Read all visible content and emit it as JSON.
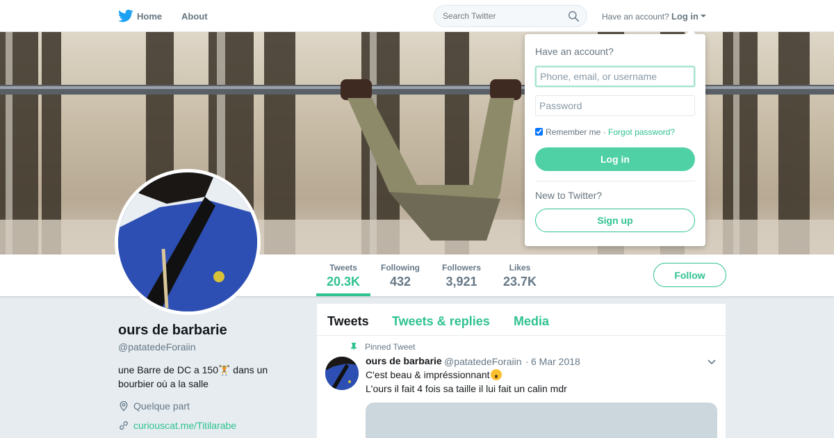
{
  "nav": {
    "home_label": "Home",
    "about_label": "About",
    "search_placeholder": "Search Twitter",
    "account_prompt": "Have an account?",
    "login_label": "Log in"
  },
  "profile": {
    "name": "ours de barbarie",
    "handle": "@patatedeForaiin",
    "bio": "une Barre de DC a 150🏋️ dans un bourbier où a la salle",
    "location": "Quelque part",
    "link": "curiouscat.me/Titilarabe"
  },
  "stats": [
    {
      "label": "Tweets",
      "value": "20.3K",
      "active": true
    },
    {
      "label": "Following",
      "value": "432",
      "active": false
    },
    {
      "label": "Followers",
      "value": "3,921",
      "active": false
    },
    {
      "label": "Likes",
      "value": "23.7K",
      "active": false
    }
  ],
  "follow_label": "Follow",
  "timeline": {
    "tabs": [
      "Tweets",
      "Tweets & replies",
      "Media"
    ],
    "pinned_label": "Pinned Tweet",
    "tweet": {
      "name": "ours de barbarie",
      "handle": "@patatedeForaiin",
      "separator": "·",
      "date": "6 Mar 2018",
      "line1": "C'est beau & impréssionnant",
      "line2": "L'ours il fait 4 fois sa taille il lui fait un calin mdr"
    }
  },
  "login_dropdown": {
    "title": "Have an account?",
    "username_placeholder": "Phone, email, or username",
    "password_placeholder": "Password",
    "remember_label": "Remember me",
    "separator": "·",
    "forgot_label": "Forgot password?",
    "login_button": "Log in",
    "new_prompt": "New to Twitter?",
    "signup_button": "Sign up"
  },
  "colors": {
    "accent": "#2fc28f",
    "muted_text": "#657786",
    "page_background": "#e6ecf0"
  }
}
